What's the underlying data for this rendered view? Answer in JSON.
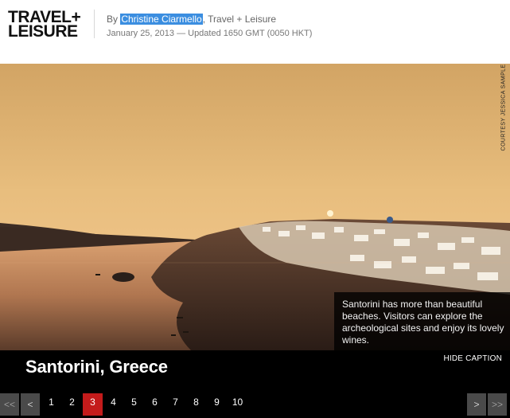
{
  "header": {
    "logo_line1": "TRAVEL+",
    "logo_line2": "LEISURE",
    "byline_prefix": "By ",
    "author": "Christine Ciarmello",
    "byline_suffix": ", Travel + Leisure",
    "dateline": "January 25, 2013 — Updated 1650 GMT (0050 HKT)"
  },
  "photo": {
    "credit": "COURTESY JESSICA SAMPLE",
    "caption": "Santorini has more than beautiful beaches. Visitors can explore the archeological sites and enjoy its lovely wines."
  },
  "slide": {
    "title": "Santorini, Greece",
    "hide_caption": "HIDE CAPTION"
  },
  "pager": {
    "first": "<<",
    "prev": "<",
    "next": ">",
    "last": ">>",
    "pages": [
      "1",
      "2",
      "3",
      "4",
      "5",
      "6",
      "7",
      "8",
      "9",
      "10"
    ],
    "current_page": "3"
  },
  "colors": {
    "accent_active": "#c41b1b",
    "author_highlight": "#3b8ee0"
  }
}
